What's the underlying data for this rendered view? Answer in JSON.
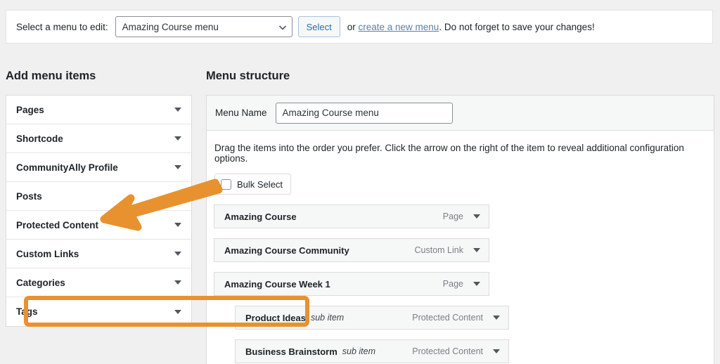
{
  "topbar": {
    "label": "Select a menu to edit:",
    "selected_menu": "Amazing Course menu",
    "select_button": "Select",
    "tail_prefix": "or ",
    "link_text": "create a new menu",
    "tail_suffix": ". Do not forget to save your changes!",
    "caret_icon": "chevron-down-icon",
    "link_color": "#5b81a8",
    "button_color": "#2271b1"
  },
  "headings": {
    "add_menu_items": "Add menu items",
    "menu_structure": "Menu structure"
  },
  "sidebar": {
    "items": [
      {
        "label": "Pages",
        "caret": true
      },
      {
        "label": "Shortcode",
        "caret": true
      },
      {
        "label": "CommunityAlly Profile",
        "caret": true
      },
      {
        "label": "Posts",
        "caret": false
      },
      {
        "label": "Protected Content",
        "caret": true
      },
      {
        "label": "Custom Links",
        "caret": true
      },
      {
        "label": "Categories",
        "caret": true
      },
      {
        "label": "Tags",
        "caret": true
      }
    ]
  },
  "panel": {
    "menu_name_label": "Menu Name",
    "menu_name_value": "Amazing Course menu",
    "menu_name_placeholder": "Enter menu name here",
    "drag_hint": "Drag the items into the order you prefer. Click the arrow on the right of the item to reveal additional configuration options.",
    "bulk_select_label": "Bulk Select",
    "bulk_select_checked": false,
    "menu_items": [
      {
        "title": "Amazing Course",
        "sub_label": "",
        "type": "Page",
        "level": 0,
        "highlighted": false
      },
      {
        "title": "Amazing Course Community",
        "sub_label": "",
        "type": "Custom Link",
        "level": 0,
        "highlighted": false
      },
      {
        "title": "Amazing Course Week 1",
        "sub_label": "",
        "type": "Page",
        "level": 0,
        "highlighted": false
      },
      {
        "title": "Product Ideas",
        "sub_label": "sub item",
        "type": "Protected Content",
        "level": 1,
        "highlighted": true
      },
      {
        "title": "Business Brainstorm",
        "sub_label": "sub item",
        "type": "Protected Content",
        "level": 1,
        "highlighted": false
      }
    ]
  },
  "annotations": {
    "arrow_color": "#e8922f",
    "highlight_color": "#e8922f",
    "arrow_points_to": "Protected Content",
    "highlight_target": "Product Ideas"
  }
}
